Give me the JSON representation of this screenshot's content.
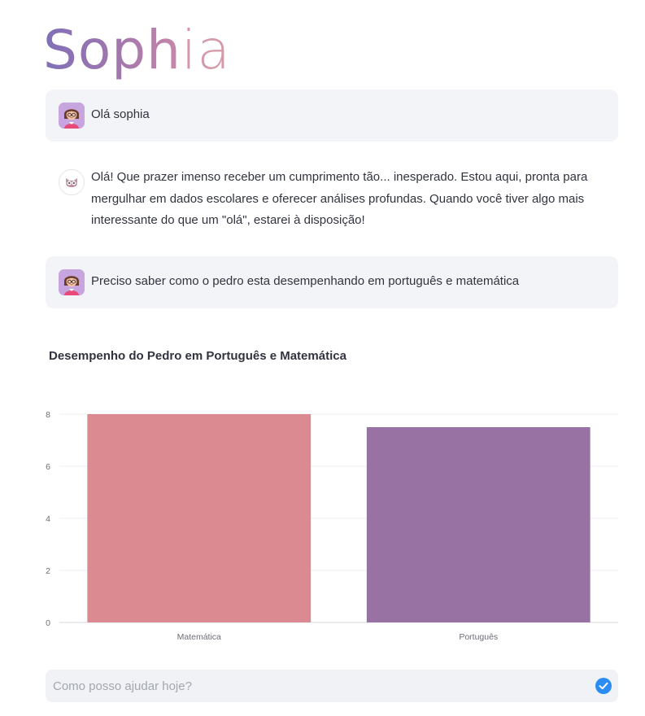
{
  "app": {
    "logo_bold": "Soph",
    "logo_thin": "ia"
  },
  "messages": [
    {
      "role": "user",
      "avatar": "student-avatar-icon",
      "text": "Olá sophia"
    },
    {
      "role": "assistant",
      "avatar": "owl-avatar-icon",
      "text": "Olá! Que prazer imenso receber um cumprimento tão... inesperado. Estou aqui, pronta para mergulhar em dados escolares e oferecer análises profundas. Quando você tiver algo mais interessante do que um \"olá\", estarei à disposição!"
    },
    {
      "role": "user",
      "avatar": "student-avatar-icon",
      "text": "Preciso saber como o pedro esta desempenhando em português e matemática"
    }
  ],
  "chart_data": {
    "type": "bar",
    "title": "Desempenho do Pedro em Português e Matemática",
    "categories": [
      "Matemática",
      "Português"
    ],
    "values": [
      8,
      7.5
    ],
    "colors": [
      "#db8a91",
      "#9872a3"
    ],
    "ylim": [
      0,
      8
    ],
    "yticks": [
      "0",
      "2",
      "4",
      "6",
      "8"
    ],
    "xlabel": "",
    "ylabel": "",
    "grid": true
  },
  "chat_input": {
    "placeholder": "Como posso ajudar hoje?",
    "value": "",
    "send_icon": "send-icon",
    "send_color": "#2b8df3"
  }
}
